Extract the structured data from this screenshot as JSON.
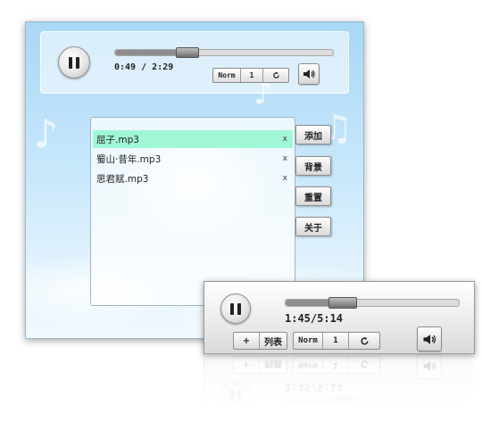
{
  "main_player": {
    "current_time": "0:49",
    "total_time": "2:29",
    "time_separator": " / ",
    "progress": 0.33,
    "mode_label": "Norm",
    "repeat_count": "1",
    "icons": {
      "play_state": "pause-icon",
      "repeat": "repeat-icon",
      "volume": "speaker-icon"
    }
  },
  "playlist": {
    "items": [
      {
        "title": "屈子.mp3",
        "remove_label": "x",
        "active": true
      },
      {
        "title": "蜀山·昔年.mp3",
        "remove_label": "x",
        "active": false
      },
      {
        "title": "思君赋.mp3",
        "remove_label": "x",
        "active": false
      }
    ],
    "highlight_color": "#9ff7d6"
  },
  "side_buttons": {
    "add": "添加",
    "background": "背景",
    "reset": "重置",
    "about": "关于"
  },
  "mini_player": {
    "time_display": "1:45/5:14",
    "progress": 0.33,
    "add_label": "+",
    "list_label": "列表",
    "mode_label": "Norm",
    "repeat_count": "1"
  }
}
